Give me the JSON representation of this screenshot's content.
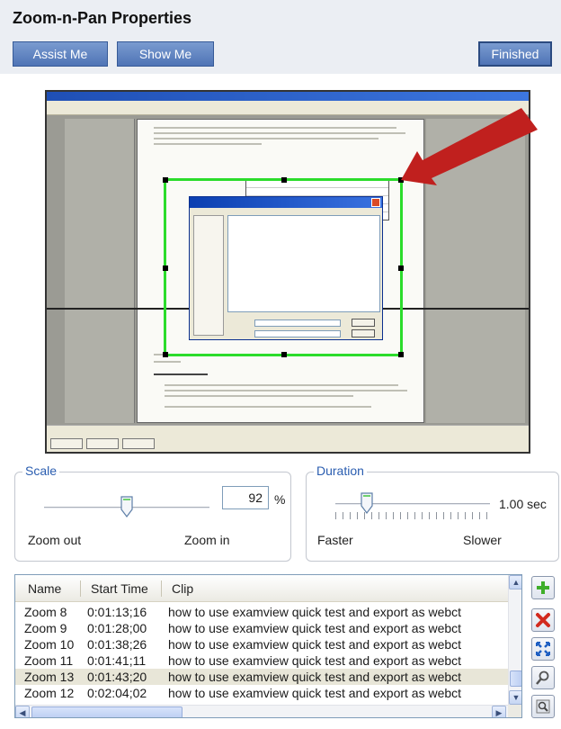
{
  "header": {
    "title": "Zoom-n-Pan Properties",
    "assist_label": "Assist Me",
    "show_label": "Show Me",
    "finished_label": "Finished"
  },
  "scale": {
    "legend": "Scale",
    "value": "92",
    "unit": "%",
    "min_label": "Zoom out",
    "max_label": "Zoom in"
  },
  "duration": {
    "legend": "Duration",
    "value_text": "1.00 sec",
    "min_label": "Faster",
    "max_label": "Slower"
  },
  "list": {
    "columns": [
      "Name",
      "Start Time",
      "Clip"
    ],
    "rows": [
      {
        "name": "Zoom 8",
        "start": "0:01:13;16",
        "clip": "how to use examview quick test and export as webct"
      },
      {
        "name": "Zoom 9",
        "start": "0:01:28;00",
        "clip": "how to use examview quick test and export as webct"
      },
      {
        "name": "Zoom 10",
        "start": "0:01:38;26",
        "clip": "how to use examview quick test and export as webct"
      },
      {
        "name": "Zoom 11",
        "start": "0:01:41;11",
        "clip": "how to use examview quick test and export as webct"
      },
      {
        "name": "Zoom 13",
        "start": "0:01:43;20",
        "clip": "how to use examview quick test and export as webct"
      },
      {
        "name": "Zoom 12",
        "start": "0:02:04;02",
        "clip": "how to use examview quick test and export as webct"
      }
    ],
    "selected_index": 4
  },
  "side_buttons": [
    "add-icon",
    "delete-icon",
    "fit-icon",
    "zoom-to-selection-icon",
    "zoom-preview-icon"
  ],
  "colors": {
    "accent_blue": "#4f74b6",
    "zoom_rect": "#2bdc2b",
    "arrow": "#c0201e"
  }
}
